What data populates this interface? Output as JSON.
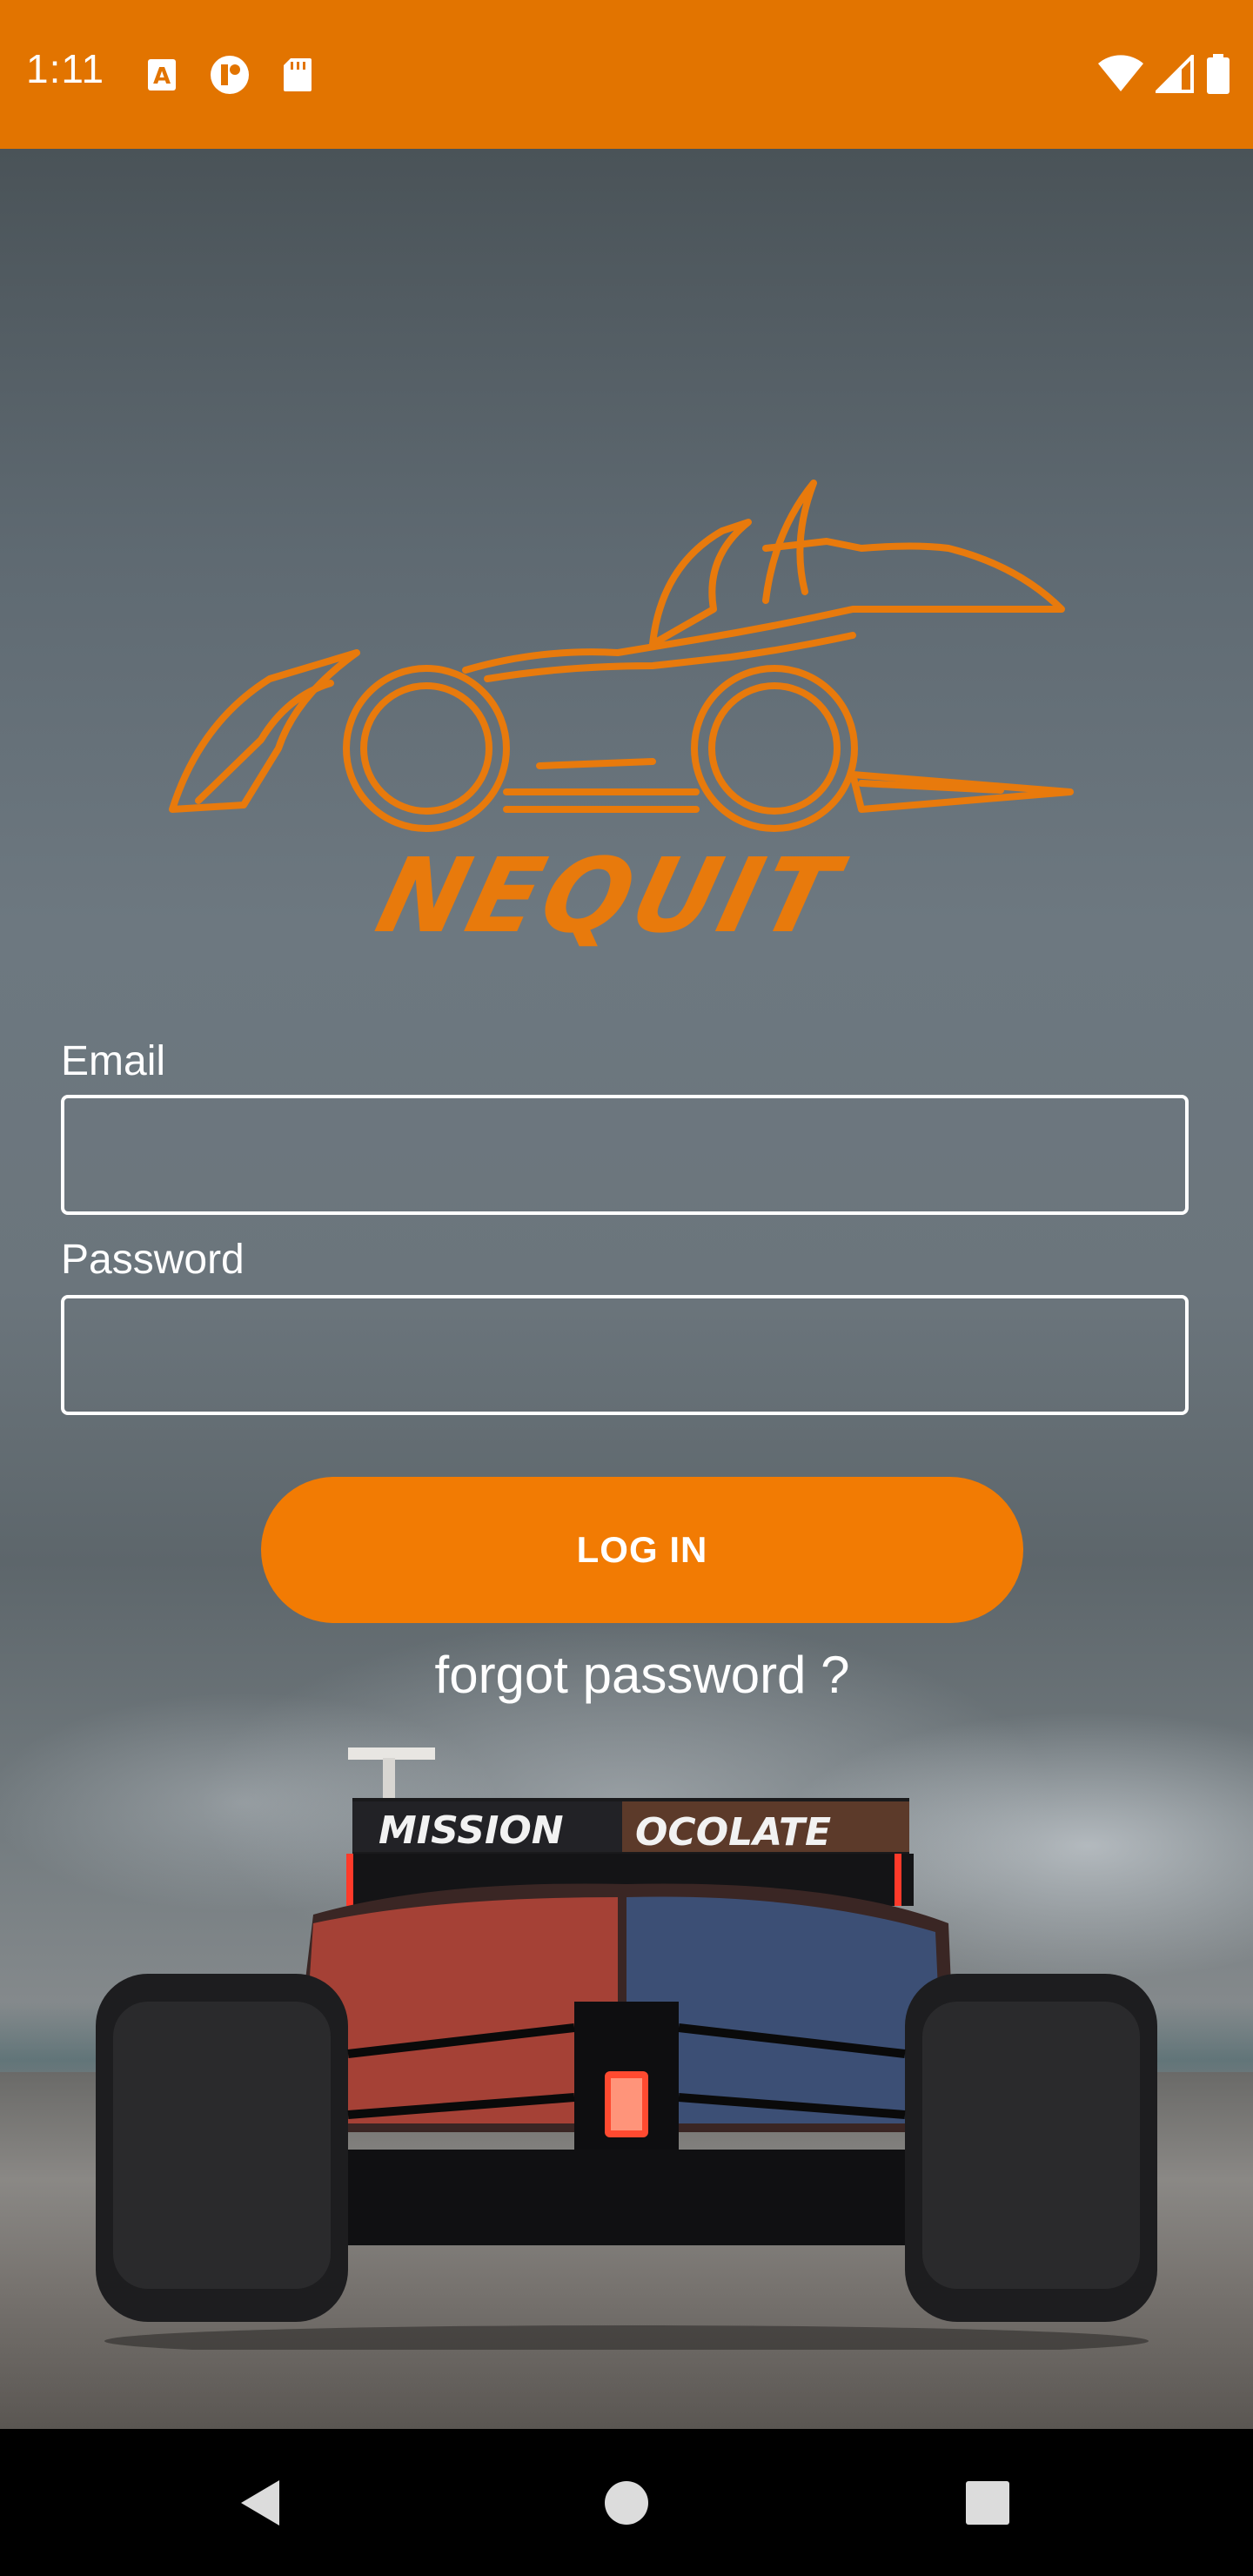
{
  "status_bar": {
    "time": "1:11",
    "background_color": "#e27400",
    "left_icons": [
      "font-icon",
      "notification-app-icon",
      "sd-card-icon"
    ],
    "right_icons": [
      "wifi-icon",
      "signal-icon",
      "battery-icon"
    ]
  },
  "logo": {
    "brand_name": "NEQUIT",
    "color": "#e87a0c"
  },
  "form": {
    "email_label": "Email",
    "email_value": "",
    "password_label": "Password",
    "password_value": "",
    "login_label": "LOG IN",
    "forgot_label": "forgot password ?",
    "accent_color": "#f27b03"
  },
  "background_image": {
    "wing_text_left": "MISSION",
    "wing_text_right": "OCOLATE"
  },
  "nav_bar": {
    "icons": [
      "back-icon",
      "home-icon",
      "recents-icon"
    ]
  }
}
